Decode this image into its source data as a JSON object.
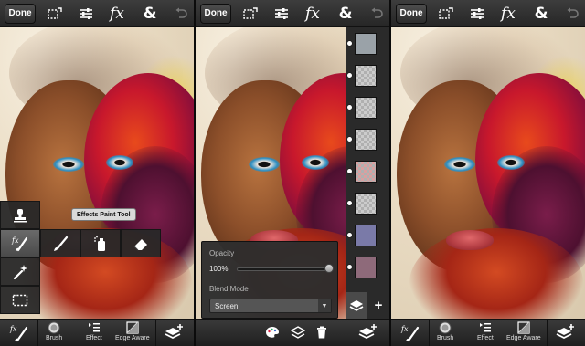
{
  "toolbar": {
    "done_label": "Done",
    "fx_label": "fx",
    "amp_label": "&",
    "icons": [
      "selection-icon",
      "adjustments-icon",
      "fx-icon",
      "ampersand-icon",
      "undo-icon"
    ]
  },
  "panel1": {
    "tooltip": "Effects Paint Tool",
    "bottom": {
      "brush_label": "Brush",
      "effect_label": "Effect",
      "edge_label": "Edge Aware"
    }
  },
  "panel2": {
    "opacity_label": "Opacity",
    "opacity_value": "100%",
    "opacity_level": 1.0,
    "blend_label": "Blend Mode",
    "blend_value": "Screen",
    "add_label": "+",
    "layer_count": 8
  },
  "panel3": {
    "bottom": {
      "brush_label": "Brush",
      "effect_label": "Effect",
      "edge_label": "Edge Aware"
    }
  },
  "colors": {
    "toolbar_bg": "#2f2f2f",
    "accent_lips": "#c0464c",
    "paint_red": "#d32a20"
  }
}
